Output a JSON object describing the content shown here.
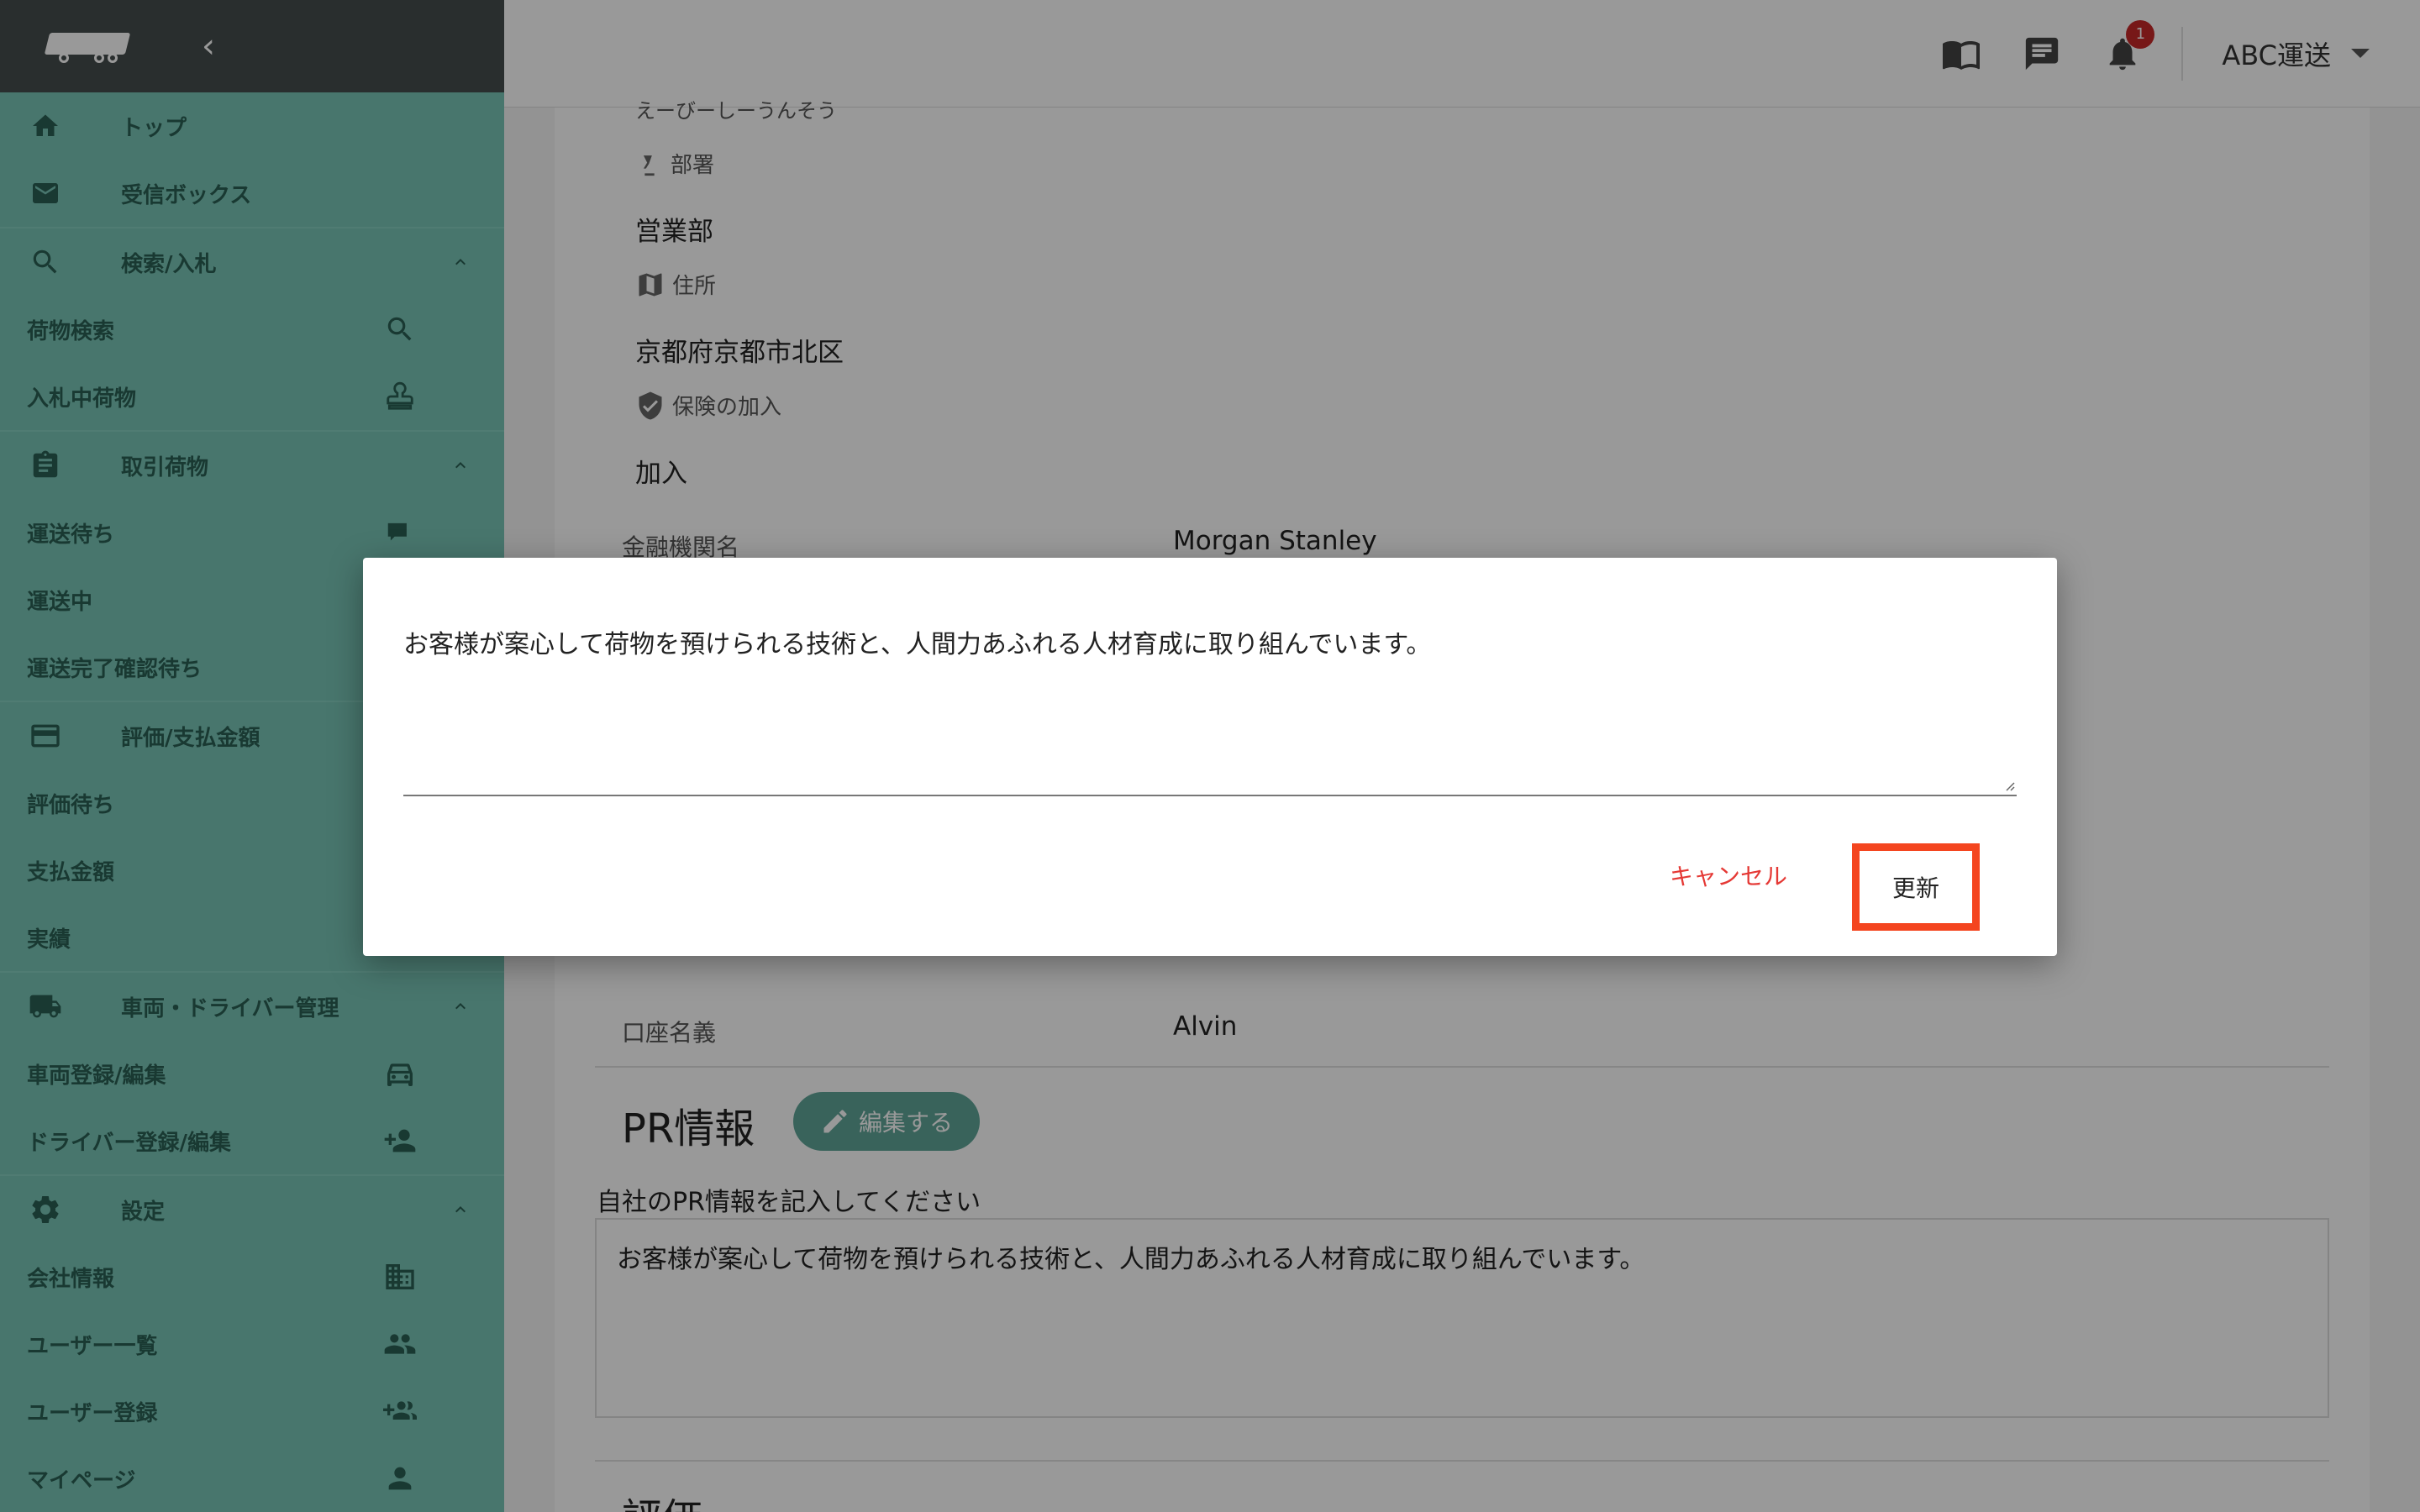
{
  "header": {
    "company": "ABC運送",
    "notification_count": "1"
  },
  "sidebar": {
    "collapse_glyph": "‹",
    "top_items": [
      {
        "label": "トップ",
        "icon": "home-icon"
      },
      {
        "label": "受信ボックス",
        "icon": "mail-icon"
      }
    ],
    "sections": [
      {
        "label": "検索/入札",
        "icon": "search-icon",
        "items": [
          {
            "label": "荷物検索",
            "icon": "search-icon"
          },
          {
            "label": "入札中荷物",
            "icon": "stamp-icon"
          }
        ]
      },
      {
        "label": "取引荷物",
        "icon": "clipboard-icon",
        "items": [
          {
            "label": "運送待ち",
            "icon": "truck-icon"
          },
          {
            "label": "運送中",
            "icon": ""
          },
          {
            "label": "運送完了確認待ち",
            "icon": ""
          }
        ]
      },
      {
        "label": "評価/支払金額",
        "icon": "credit-card-icon",
        "items": [
          {
            "label": "評価待ち",
            "icon": ""
          },
          {
            "label": "支払金額",
            "icon": ""
          },
          {
            "label": "実績",
            "icon": ""
          }
        ]
      },
      {
        "label": "車両・ドライバー管理",
        "icon": "truck-icon",
        "items": [
          {
            "label": "車両登録/編集",
            "icon": "car-icon"
          },
          {
            "label": "ドライバー登録/編集",
            "icon": "person-add-icon"
          }
        ]
      },
      {
        "label": "設定",
        "icon": "gear-icon",
        "items": [
          {
            "label": "会社情報",
            "icon": "building-icon"
          },
          {
            "label": "ユーザー一覧",
            "icon": "people-icon"
          },
          {
            "label": "ユーザー登録",
            "icon": "group-add-icon"
          },
          {
            "label": "マイページ",
            "icon": "person-icon"
          }
        ]
      }
    ]
  },
  "profile": {
    "furigana": "えーびーしーうんそう",
    "department_label": "部署",
    "department": "営業部",
    "address_label": "住所",
    "address": "京都府京都市北区",
    "insurance_label": "保険の加入",
    "insurance": "加入",
    "bank_label": "金融機関名",
    "bank": "Morgan Stanley",
    "account_name_label": "口座名義",
    "account_name": "Alvin"
  },
  "pr": {
    "title": "PR情報",
    "edit_label": "編集する",
    "help": "自社のPR情報を記入してください",
    "text": "お客様が案心して荷物を預けられる技術と、人間力あふれる人材育成に取り組んでいます。"
  },
  "next_section_title": "評価",
  "dialog": {
    "text": "お客様が案心して荷物を預けられる技術と、人間力あふれる人材育成に取り組んでいます。",
    "cancel_label": "キャンセル",
    "update_label": "更新"
  },
  "colors": {
    "sidebar_bg": "#78c5b6",
    "sidebar_header": "#454e4d",
    "accent": "#5fa598",
    "highlight": "#f4451f",
    "cancel": "#e53935"
  }
}
